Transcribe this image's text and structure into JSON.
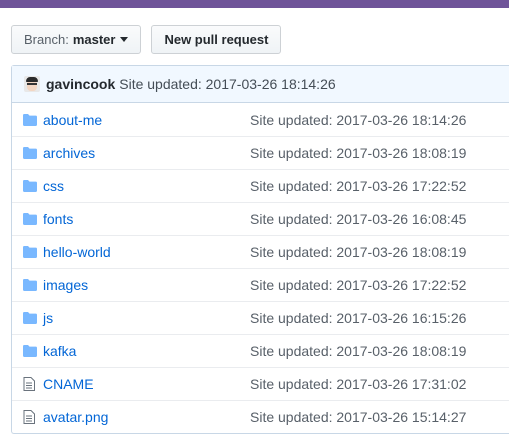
{
  "toolbar": {
    "branch_prefix": "Branch:",
    "branch_name": "master",
    "new_pr_label": "New pull request"
  },
  "latest_commit": {
    "author": "gavincook",
    "message": "Site updated: 2017-03-26 18:14:26"
  },
  "files": [
    {
      "type": "folder",
      "name": "about-me",
      "message": "Site updated: 2017-03-26 18:14:26"
    },
    {
      "type": "folder",
      "name": "archives",
      "message": "Site updated: 2017-03-26 18:08:19"
    },
    {
      "type": "folder",
      "name": "css",
      "message": "Site updated: 2017-03-26 17:22:52"
    },
    {
      "type": "folder",
      "name": "fonts",
      "message": "Site updated: 2017-03-26 16:08:45"
    },
    {
      "type": "folder",
      "name": "hello-world",
      "message": "Site updated: 2017-03-26 18:08:19"
    },
    {
      "type": "folder",
      "name": "images",
      "message": "Site updated: 2017-03-26 17:22:52"
    },
    {
      "type": "folder",
      "name": "js",
      "message": "Site updated: 2017-03-26 16:15:26"
    },
    {
      "type": "folder",
      "name": "kafka",
      "message": "Site updated: 2017-03-26 18:08:19"
    },
    {
      "type": "file",
      "name": "CNAME",
      "message": "Site updated: 2017-03-26 17:31:02"
    },
    {
      "type": "file",
      "name": "avatar.png",
      "message": "Site updated: 2017-03-26 15:14:27"
    }
  ],
  "colors": {
    "accent_bar": "#6f5499",
    "link": "#0366d6",
    "commit_bar_bg": "#f1f8ff",
    "folder_icon": "#79b8ff"
  }
}
